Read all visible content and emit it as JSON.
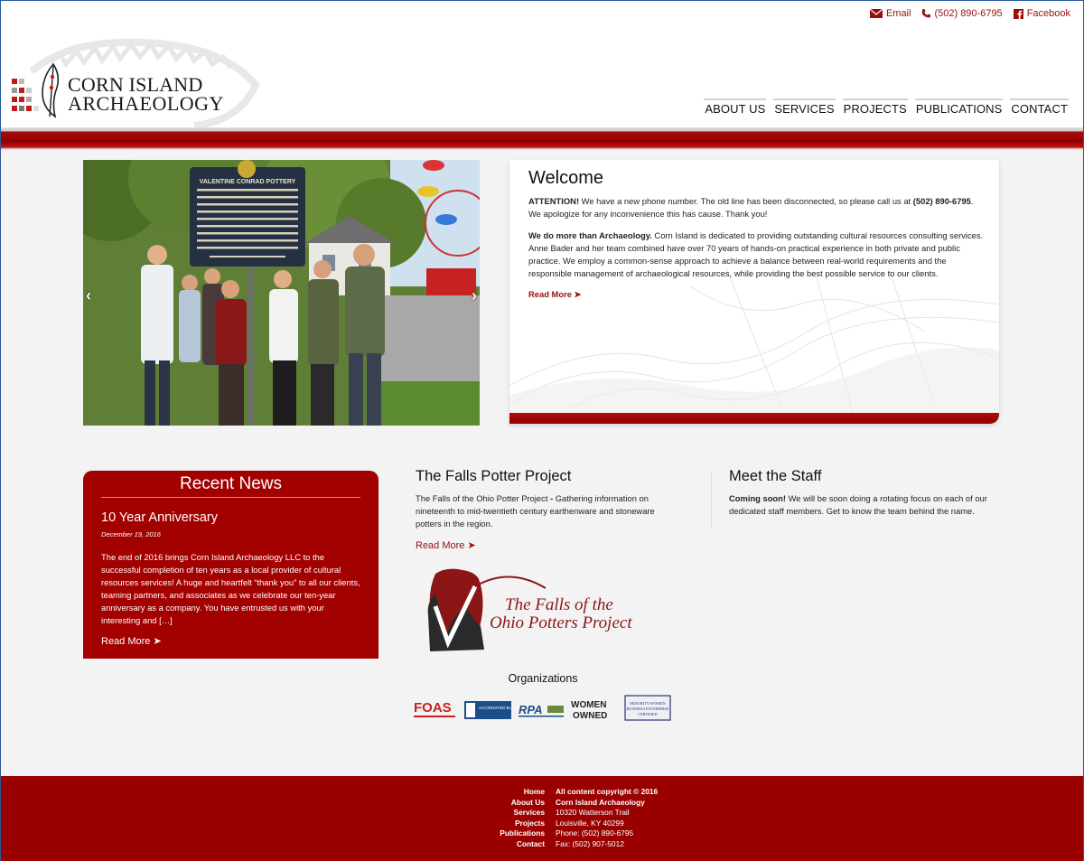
{
  "topbar": {
    "email": "Email",
    "phone": "(502) 890-6795",
    "facebook": "Facebook"
  },
  "logo": {
    "line1": "CORN ISLAND",
    "line2": "ARCHAEOLOGY"
  },
  "nav": [
    "ABOUT US",
    "SERVICES",
    "PROJECTS",
    "PUBLICATIONS",
    "CONTACT"
  ],
  "slider": {
    "marker_title": "VALENTINE CONRAD POTTERY",
    "marker_text": "By 1805, Valentine Conrad settled in Jeffersontown & began producing decorated redware in variety of functional and decorative forms. Conrad, a farmer-potter, was very successful. His wares, made from local clays, were widely traded throughout the region. He & son William, fired vessels in brick kilns on this site until ca. 1837.",
    "marker_footer": "Falls of the Ohio Archaeological Society"
  },
  "welcome": {
    "title": "Welcome",
    "p1_bold": "ATTENTION!",
    "p1_a": " We have a new phone number. The old line has been disconnected, so please call us at ",
    "p1_phone": "(502) 890-6795",
    "p1_b": ". We apologize for any inconvenience this has cause. Thank you!",
    "p2_bold": "We do more than Archaeology.",
    "p2_text": " Corn Island is dedicated to providing outstanding cultural resources consulting services. Anne Bader and her team combined have over 70 years of hands-on practical experience in both private and public practice. We employ a common-sense approach to achieve a balance between real-world requirements and the responsible management of archaeological resources, while providing the best possible service to our clients.",
    "read_more": "Read More"
  },
  "news": {
    "heading": "Recent News",
    "title": "10 Year Anniversary",
    "date": "December 19, 2016",
    "excerpt": "The end of 2016 brings Corn Island Archaeology LLC to the successful completion of ten years as a local provider of cultural resources services! A huge and heartfelt “thank you” to all our clients, teaming partners, and associates as we celebrate our ten-year anniversary as a company. You have entrusted us with your interesting and […]",
    "read_more": "Read More"
  },
  "falls": {
    "title": "The Falls Potter Project",
    "text_a": "The Falls of the Ohio Potter Project ",
    "text_dash": "-",
    "text_b": " Gathering information on nineteenth to mid-twentieth century earthenware and stoneware potters in the region.",
    "read_more": "Read More",
    "logo_line1": "The Falls of the",
    "logo_line2": "Ohio Potters Project"
  },
  "staff": {
    "title": "Meet the Staff",
    "bold": "Coming soon!",
    "text": " We will be soon doing a rotating focus on each of our dedicated staff members. Get to know the team behind the name."
  },
  "orgs": {
    "heading": "Organizations",
    "foas": "FOAS",
    "bbb": "ACCREDITED BUSINESS",
    "rpa": "RPA",
    "women1": "WOMEN",
    "women2": "OWNED",
    "mwbe1": "MINORITY/WOMEN",
    "mwbe2": "BUSINESS ENTERPRISE",
    "mwbe3": "CERTIFIED"
  },
  "footer": {
    "links": [
      "Home",
      "About Us",
      "Services",
      "Projects",
      "Publications",
      "Contact"
    ],
    "copyright": "All content copyright © 2016",
    "company": "Corn Island Archaeology",
    "address1": "10320 Watterson Trail",
    "address2": "Louisville, KY 40299",
    "phone": "Phone: (502) 890-6795",
    "fax": "Fax: (502) 907-5012"
  },
  "colors": {
    "brand_red": "#9b0000",
    "accent_red": "#a30000"
  }
}
